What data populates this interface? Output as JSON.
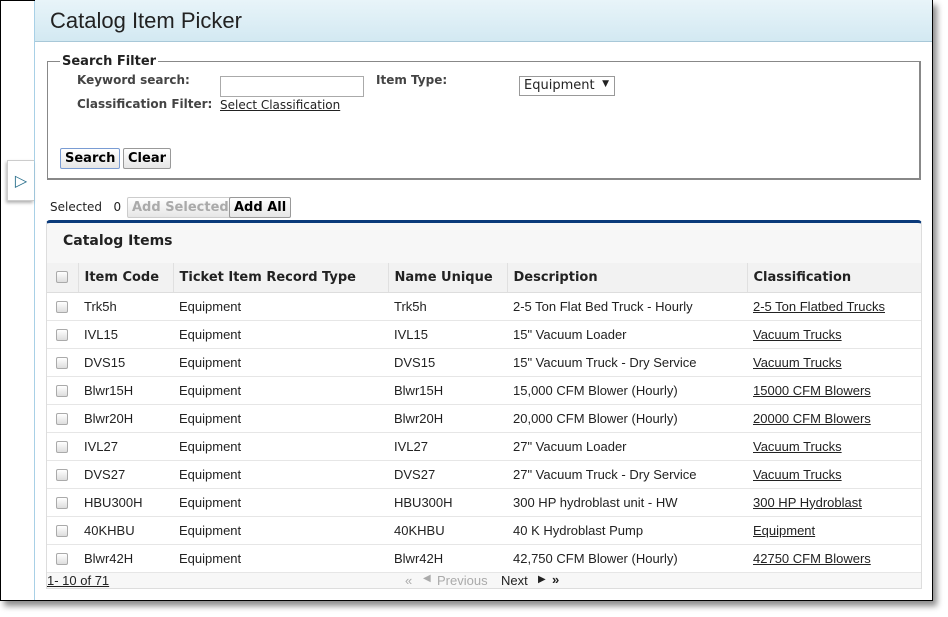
{
  "window": {
    "title": "Catalog Item Picker"
  },
  "filter": {
    "legend": "Search Filter",
    "keyword_label": "Keyword search:",
    "keyword_value": "",
    "classification_label": "Classification Filter:",
    "classification_link": "Select Classification",
    "item_type_label": "Item Type:",
    "item_type_value": "Equipment",
    "search_btn": "Search",
    "clear_btn": "Clear"
  },
  "selection": {
    "label": "Selected",
    "count": "0",
    "add_selected": "Add Selected",
    "add_all": "Add All"
  },
  "table": {
    "title": "Catalog Items",
    "columns": [
      "Item Code",
      "Ticket Item Record Type",
      "Name Unique",
      "Description",
      "Classification"
    ],
    "rows": [
      [
        "Trk5h",
        "Equipment",
        "Trk5h",
        "2-5 Ton Flat Bed Truck - Hourly",
        "2-5 Ton Flatbed Trucks"
      ],
      [
        "IVL15",
        "Equipment",
        "IVL15",
        "15\" Vacuum Loader",
        "Vacuum Trucks"
      ],
      [
        "DVS15",
        "Equipment",
        "DVS15",
        "15\" Vacuum Truck - Dry Service",
        "Vacuum Trucks"
      ],
      [
        "Blwr15H",
        "Equipment",
        "Blwr15H",
        "15,000 CFM Blower (Hourly)",
        "15000 CFM Blowers"
      ],
      [
        "Blwr20H",
        "Equipment",
        "Blwr20H",
        "20,000 CFM Blower (Hourly)",
        "20000 CFM Blowers"
      ],
      [
        "IVL27",
        "Equipment",
        "IVL27",
        "27\" Vacuum Loader",
        "Vacuum Trucks"
      ],
      [
        "DVS27",
        "Equipment",
        "DVS27",
        "27\" Vacuum Truck - Dry Service",
        "Vacuum Trucks"
      ],
      [
        "HBU300H",
        "Equipment",
        "HBU300H",
        "300 HP hydroblast unit - HW",
        "300 HP Hydroblast"
      ],
      [
        "40KHBU",
        "Equipment",
        "40KHBU",
        "40 K Hydroblast Pump",
        "Equipment"
      ],
      [
        "Blwr42H",
        "Equipment",
        "Blwr42H",
        "42,750 CFM Blower (Hourly)",
        "42750 CFM Blowers"
      ]
    ]
  },
  "pager": {
    "range": "1- 10  of  71",
    "previous": "Previous",
    "next": "Next"
  }
}
